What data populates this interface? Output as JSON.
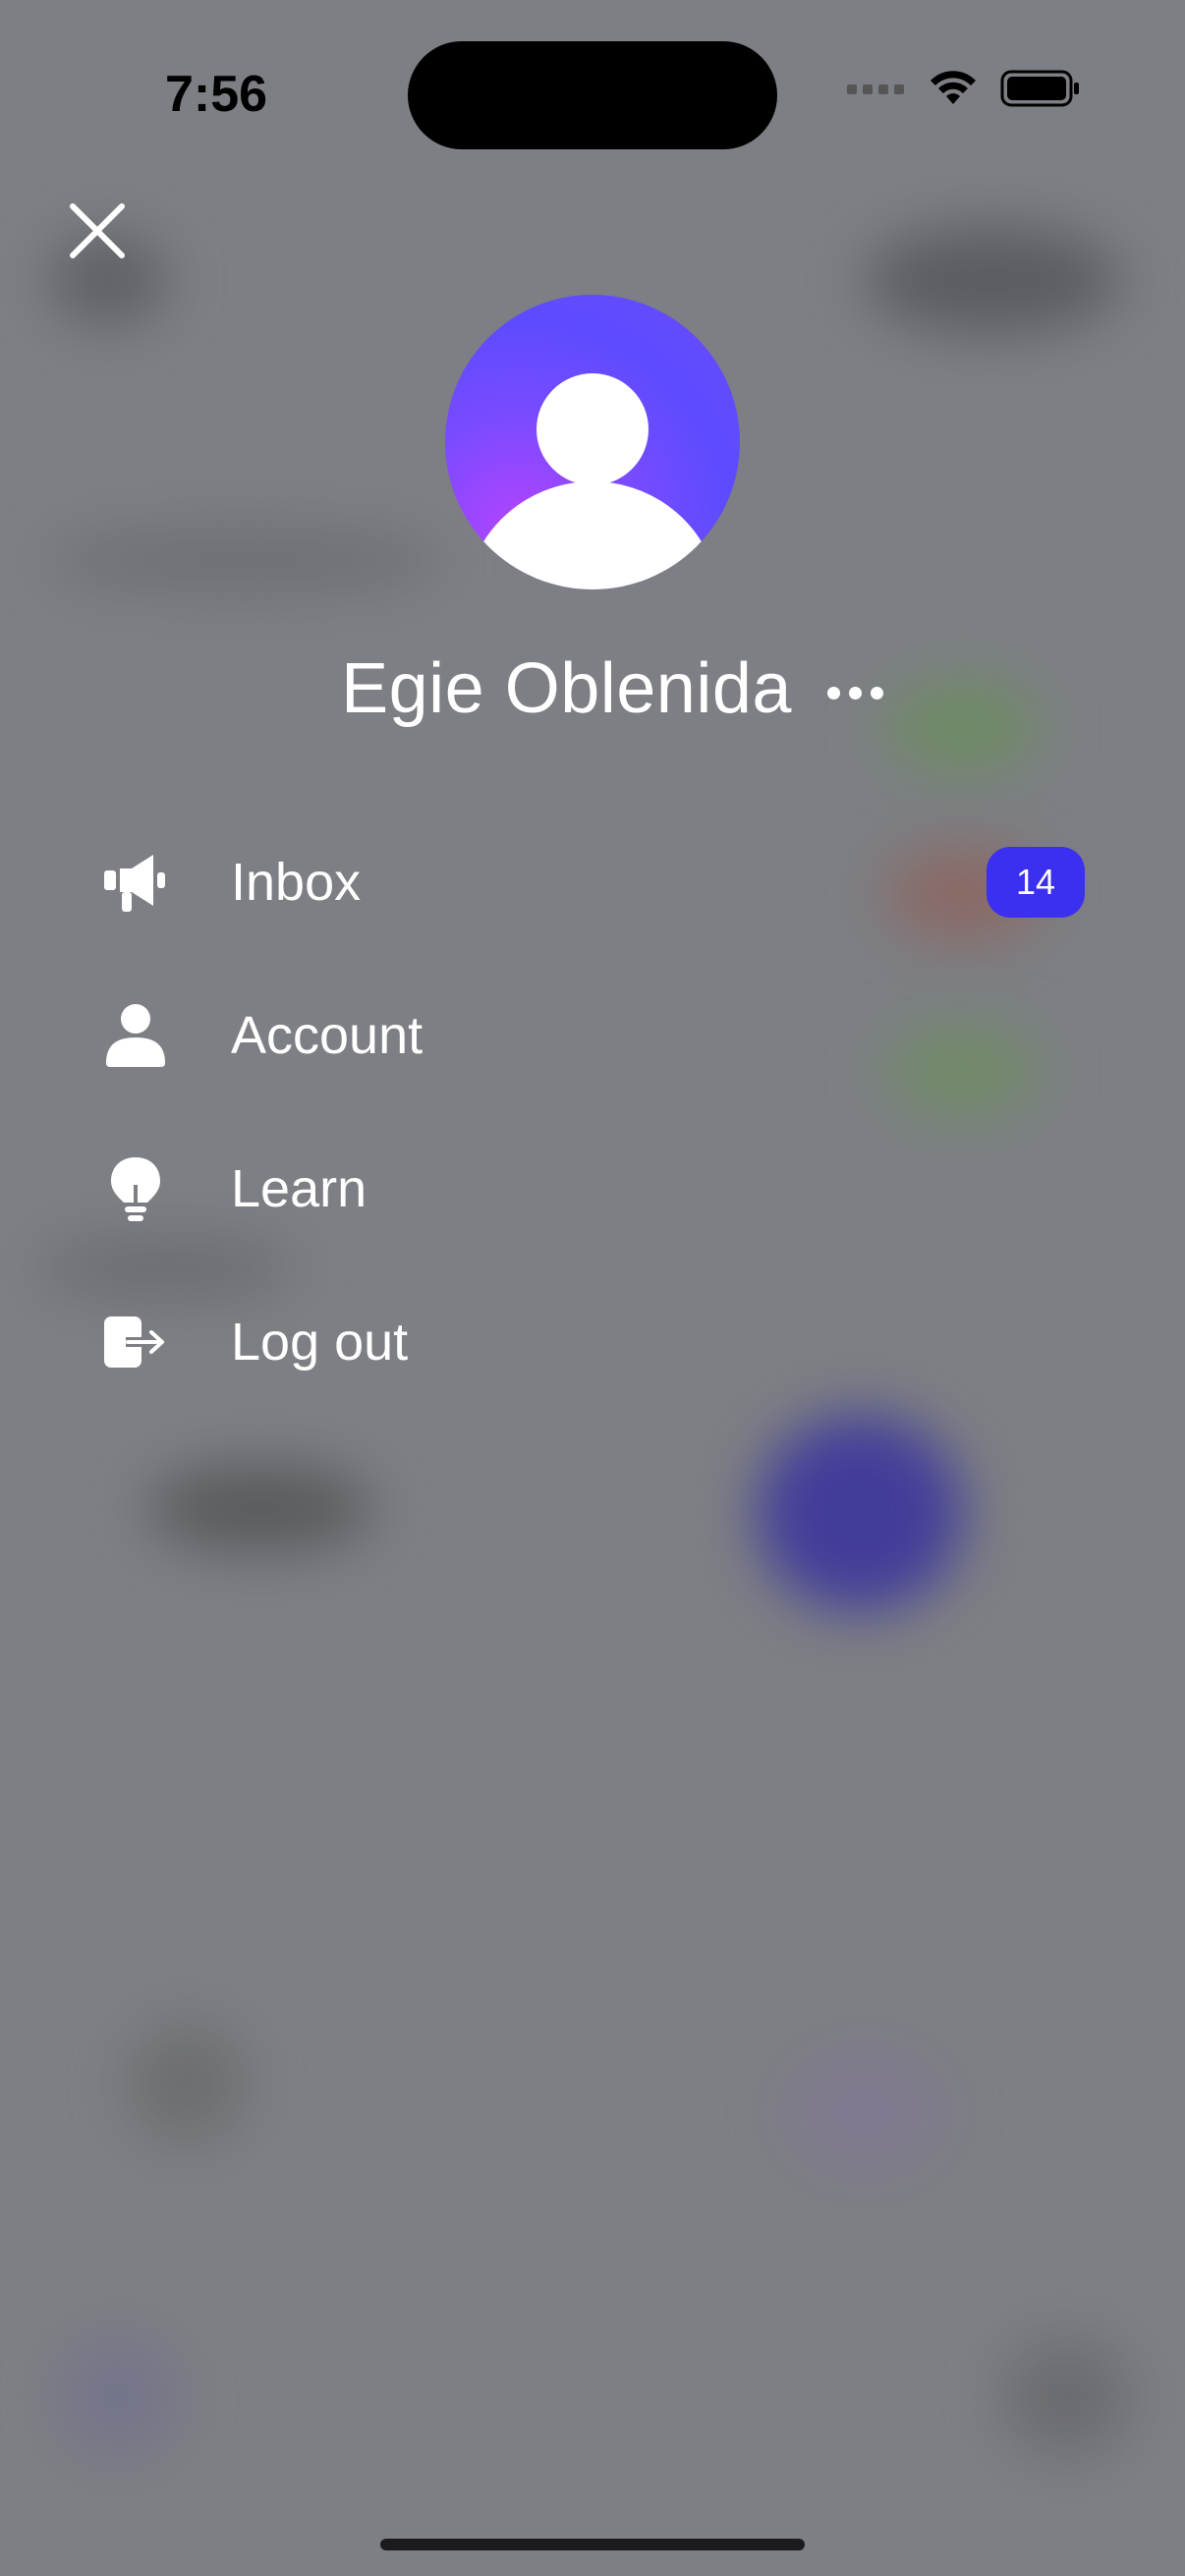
{
  "status_bar": {
    "time": "7:56"
  },
  "profile": {
    "name": "Egie Oblenida",
    "avatar_gradient": [
      "#b443ff",
      "#5d4bff"
    ]
  },
  "menu": {
    "items": [
      {
        "label": "Inbox",
        "icon": "megaphone-icon",
        "badge": "14"
      },
      {
        "label": "Account",
        "icon": "person-icon"
      },
      {
        "label": "Learn",
        "icon": "lightbulb-icon"
      },
      {
        "label": "Log out",
        "icon": "logout-icon"
      }
    ]
  },
  "colors": {
    "overlay": "#7d7f84",
    "badge": "#3b2ff0",
    "text": "#ffffff"
  }
}
